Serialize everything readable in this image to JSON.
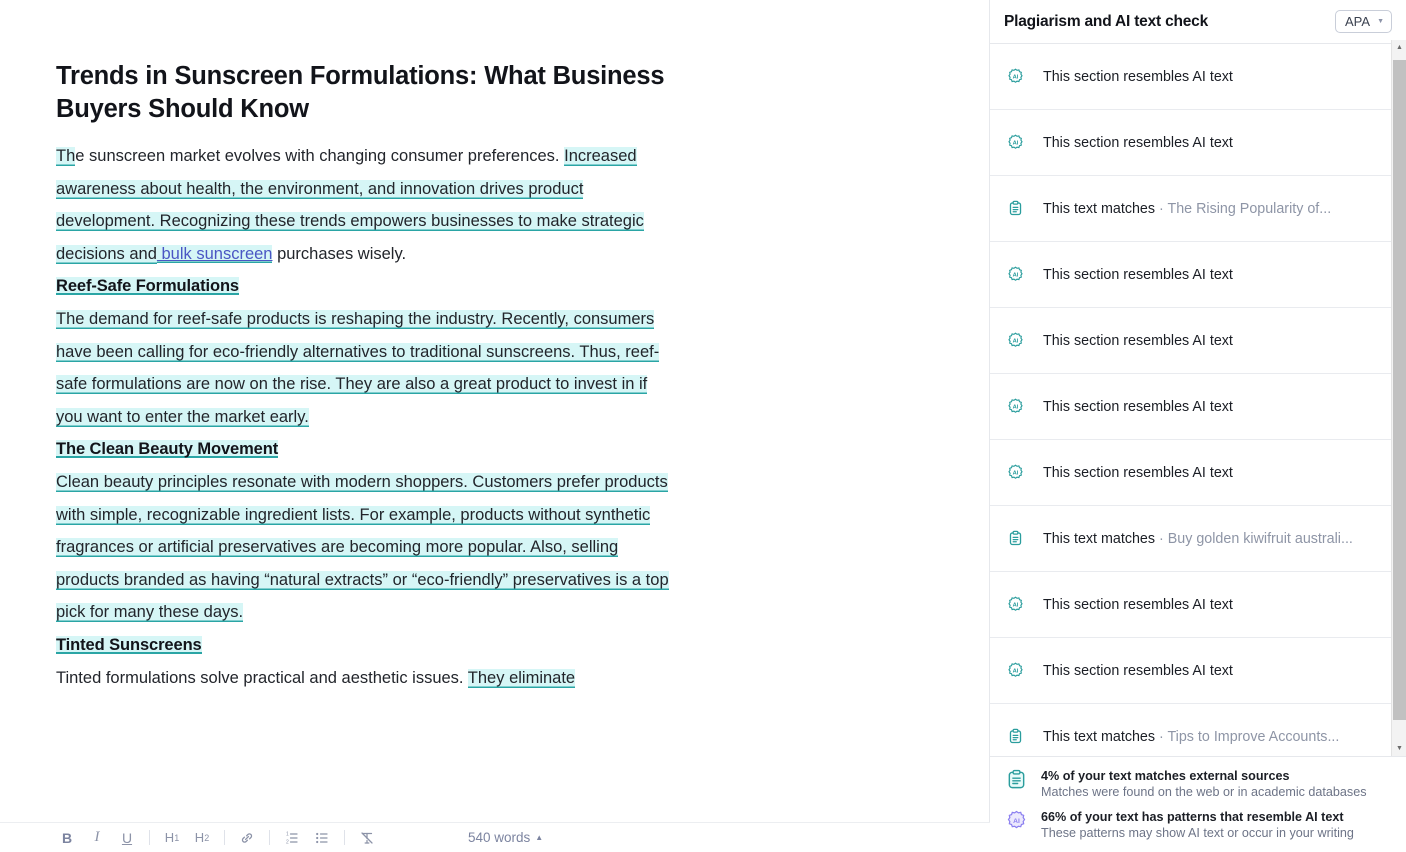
{
  "editor": {
    "title": "Trends in Sunscreen Formulations: What Business Buyers Should Know",
    "paragraph1": {
      "hl_start": "Th",
      "plain_1": "e sunscreen market evolves with changing consumer preferences.",
      "hl_2": "Increased awareness about health, the environment, and innovation drives product development. Recognizing these trends empowers businesses to make strategic decisions and",
      "link": " bulk sunscreen",
      "plain_tail": " purchases wisely."
    },
    "section1": {
      "heading": "Reef-Safe Formulations",
      "body_a": "The demand for reef-safe products is reshaping the industry. Recently, consumers have been calling for eco-friendly alternatives to ",
      "body_b": "traditional sunscreens. Thus, reef-safe formulations are now on the rise. They are also a great product to invest in if you want to enter the market early."
    },
    "section2": {
      "heading": "The Clean Beauty Movement",
      "body": "Clean beauty principles resonate with modern shoppers. Customers prefer products with simple, recognizable ingredient lists. For example, products without synthetic fragrances or artificial preservatives are becoming more popular. Also, selling products branded as having “natural extracts” or “eco-friendly” preservatives is a top pick for many these days. "
    },
    "section3": {
      "heading": "Tinted Sunscreens",
      "body_plain": "Tinted formulations solve practical and aesthetic issues. ",
      "body_hl": "They eliminate"
    }
  },
  "toolbar": {
    "bold": "B",
    "italic": "I",
    "underline": "U",
    "h1": "H",
    "h1_sub": "1",
    "h2": "H",
    "h2_sub": "2",
    "word_count": "540 words",
    "word_count_caret": "▲"
  },
  "panel": {
    "title": "Plagiarism and AI text check",
    "style": {
      "label": "APA",
      "caret": "▼"
    },
    "cards": [
      {
        "icon": "ai-badge-icon",
        "label": "This section resembles AI text",
        "source": ""
      },
      {
        "icon": "ai-badge-icon",
        "label": "This section resembles AI text",
        "source": ""
      },
      {
        "icon": "plagiarism-clipboard-icon",
        "label": "This text matches",
        "source": " · The Rising Popularity of..."
      },
      {
        "icon": "ai-badge-icon",
        "label": "This section resembles AI text",
        "source": ""
      },
      {
        "icon": "ai-badge-icon",
        "label": "This section resembles AI text",
        "source": ""
      },
      {
        "icon": "ai-badge-icon",
        "label": "This section resembles AI text",
        "source": ""
      },
      {
        "icon": "ai-badge-icon",
        "label": "This section resembles AI text",
        "source": ""
      },
      {
        "icon": "plagiarism-clipboard-icon",
        "label": "This text matches",
        "source": " · Buy golden kiwifruit australi..."
      },
      {
        "icon": "ai-badge-icon",
        "label": "This section resembles AI text",
        "source": ""
      },
      {
        "icon": "ai-badge-icon",
        "label": "This section resembles AI text",
        "source": ""
      },
      {
        "icon": "plagiarism-clipboard-icon",
        "label": "This text matches",
        "source": " · Tips to Improve Accounts..."
      }
    ],
    "summary": {
      "plagiarism_title": "4% of your text matches external sources",
      "plagiarism_sub": "Matches were found on the web or in academic databases",
      "ai_title": "66% of your text has patterns that resemble AI text",
      "ai_sub": "These patterns may show AI text or occur in your writing"
    },
    "scrollbar": {
      "up": "▲",
      "down": "▼"
    }
  },
  "colors": {
    "highlight_bg": "#d6f6f6",
    "highlight_underline": "#2aa5a5",
    "link": "#4a56c4",
    "teal_icon": "#2a9d9d",
    "purple_icon": "#8b7ff0"
  }
}
